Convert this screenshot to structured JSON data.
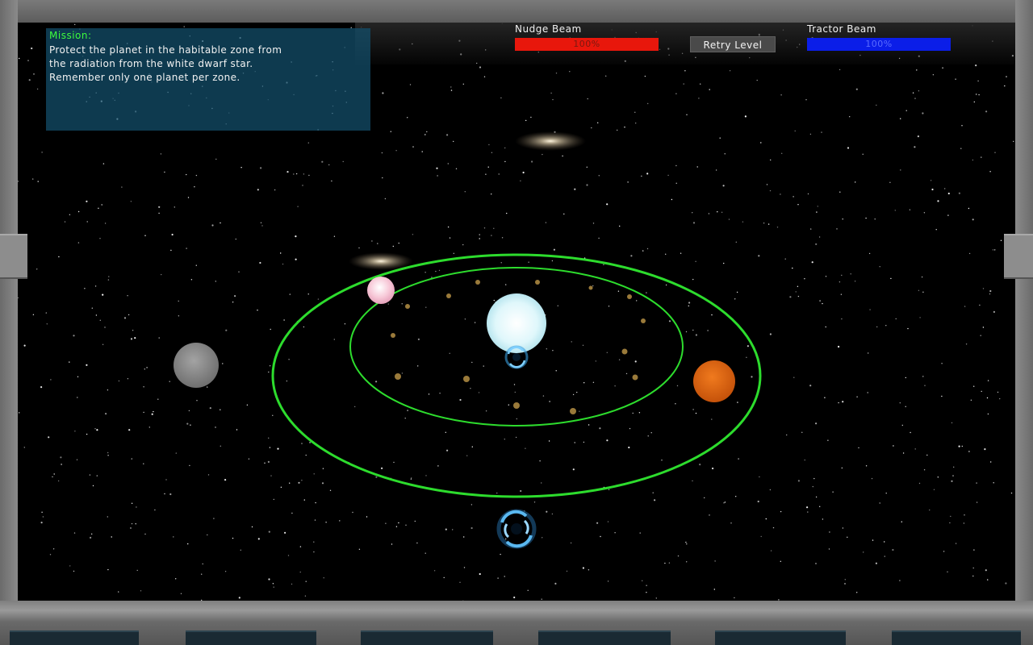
{
  "mission": {
    "title": "Mission:",
    "lines": [
      "Protect the planet in the habitable zone from",
      "the radiation from the white dwarf star.",
      "Remember only one planet per zone."
    ]
  },
  "hud": {
    "nudge_beam": {
      "label": "Nudge Beam",
      "value_text": "100%",
      "level": 1.0,
      "color": "#e8170c",
      "text_color": "#7a1810"
    },
    "tractor_beam": {
      "label": "Tractor Beam",
      "value_text": "100%",
      "level": 1.0,
      "color": "#0b1ee8",
      "text_color": "#5a6cff"
    },
    "retry_label": "Retry Level"
  },
  "colors": {
    "mission_title": "#3dfc3d",
    "orbit_ring": "#2ddc2d",
    "white_dwarf": "#dff7fb",
    "habitable_planet": "#f7c9d8",
    "hot_planet": "#e0640f",
    "cold_planet": "#8a8a8a",
    "asteroid": "#9a7a3a",
    "wormhole": "#3aa0e0"
  }
}
